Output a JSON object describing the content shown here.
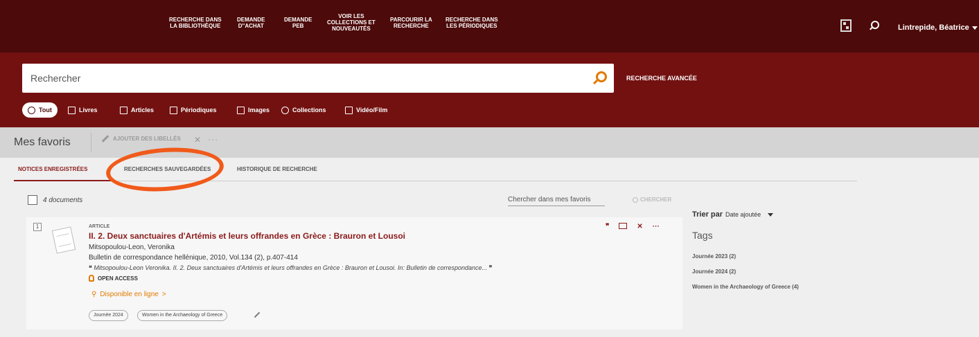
{
  "topnav": {
    "items": [
      {
        "line1": "RECHERCHE DANS",
        "line2": "LA BIBLIOTHÈQUE"
      },
      {
        "line1": "DEMANDE",
        "line2": "D''ACHAT"
      },
      {
        "line1": "DEMANDE",
        "line2": "PEB"
      },
      {
        "line1": "VOIR LES",
        "line2": "COLLECTIONS ET",
        "line3": "NOUVEAUTÉS"
      },
      {
        "line1": "PARCOURIR LA",
        "line2": "RECHERCHE"
      },
      {
        "line1": "RECHERCHE DANS",
        "line2": "LES PÉRIODIQUES"
      }
    ],
    "user_name": "Lintrepide, Béatrice"
  },
  "search": {
    "placeholder": "Rechercher",
    "advanced_label": "RECHERCHE AVANCÉE"
  },
  "filters": [
    {
      "label": "Tout",
      "icon": "search-icon"
    },
    {
      "label": "Livres",
      "icon": "book-icon"
    },
    {
      "label": "Articles",
      "icon": "article-icon"
    },
    {
      "label": "Périodiques",
      "icon": "periodical-icon"
    },
    {
      "label": "Images",
      "icon": "image-icon"
    },
    {
      "label": "Collections",
      "icon": "collections-icon"
    },
    {
      "label": "Vidéo/Film",
      "icon": "video-icon"
    }
  ],
  "favorites": {
    "title": "Mes favoris",
    "add_labels": "AJOUTER DES LIBELLÉS",
    "more": "···"
  },
  "tabs": [
    {
      "label": "NOTICES ENREGISTRÉES",
      "active": true
    },
    {
      "label": "RECHERCHES SAUVEGARDÉES",
      "active": false
    },
    {
      "label": "HISTORIQUE DE RECHERCHE",
      "active": false
    }
  ],
  "results": {
    "count_label": "4 documents",
    "search_placeholder": "Chercher dans mes favoris",
    "search_button": "CHERCHER"
  },
  "record": {
    "number": "1",
    "type": "ARTICLE",
    "title": "II. 2. Deux sanctuaires d'Artémis et leurs offrandes en Grèce : Brauron et Lousoi",
    "author": "Mitsopoulou-Leon, Veronika",
    "source": "Bulletin de correspondance hellénique, 2010, Vol.134 (2), p.407-414",
    "citation": "Mitsopoulou-Leon Veronika. II. 2. Deux sanctuaires d'Artémis et leurs offrandes en Grèce : Brauron et Lousoi. In: Bulletin de correspondance...",
    "open_access": "OPEN ACCESS",
    "online": "Disponible en ligne",
    "online_arrow": ">",
    "tags": [
      "Journée 2024",
      "Women in the Archaeology of Greece"
    ],
    "quote_icon": "❞",
    "more": "···"
  },
  "sidebar": {
    "sort_label": "Trier par",
    "sort_value": "Date ajoutée",
    "tags_title": "Tags",
    "tags": [
      "Journée 2023 (2)",
      "Journée 2024 (2)",
      "Women in the Archaeology of Greece (4)"
    ]
  },
  "colors": {
    "nav_bg": "#4d0a0a",
    "search_bg": "#731111",
    "accent": "#e07a00",
    "title_red": "#8b1a1a",
    "annotation": "#f05a1a"
  }
}
